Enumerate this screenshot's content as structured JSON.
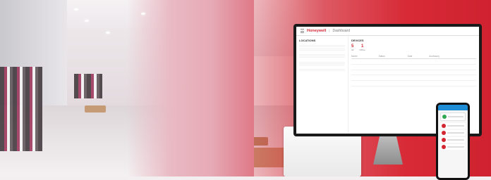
{
  "app": {
    "brand": "Honeywell",
    "breadcrumb": "Dashboard"
  },
  "locations_panel": {
    "title": "LOCATIONS"
  },
  "devices_panel": {
    "title": "DEVICES",
    "stats": [
      {
        "value": "5",
        "label": "All"
      },
      {
        "value": "1",
        "label": "Offline"
      }
    ],
    "columns": [
      "Name",
      "Status",
      "Date",
      "Accessory"
    ]
  },
  "colors": {
    "brand": "#d22630",
    "status_ok": "#2fa84f",
    "status_alert": "#d22630",
    "mobile_header": "#1f8dd6"
  }
}
